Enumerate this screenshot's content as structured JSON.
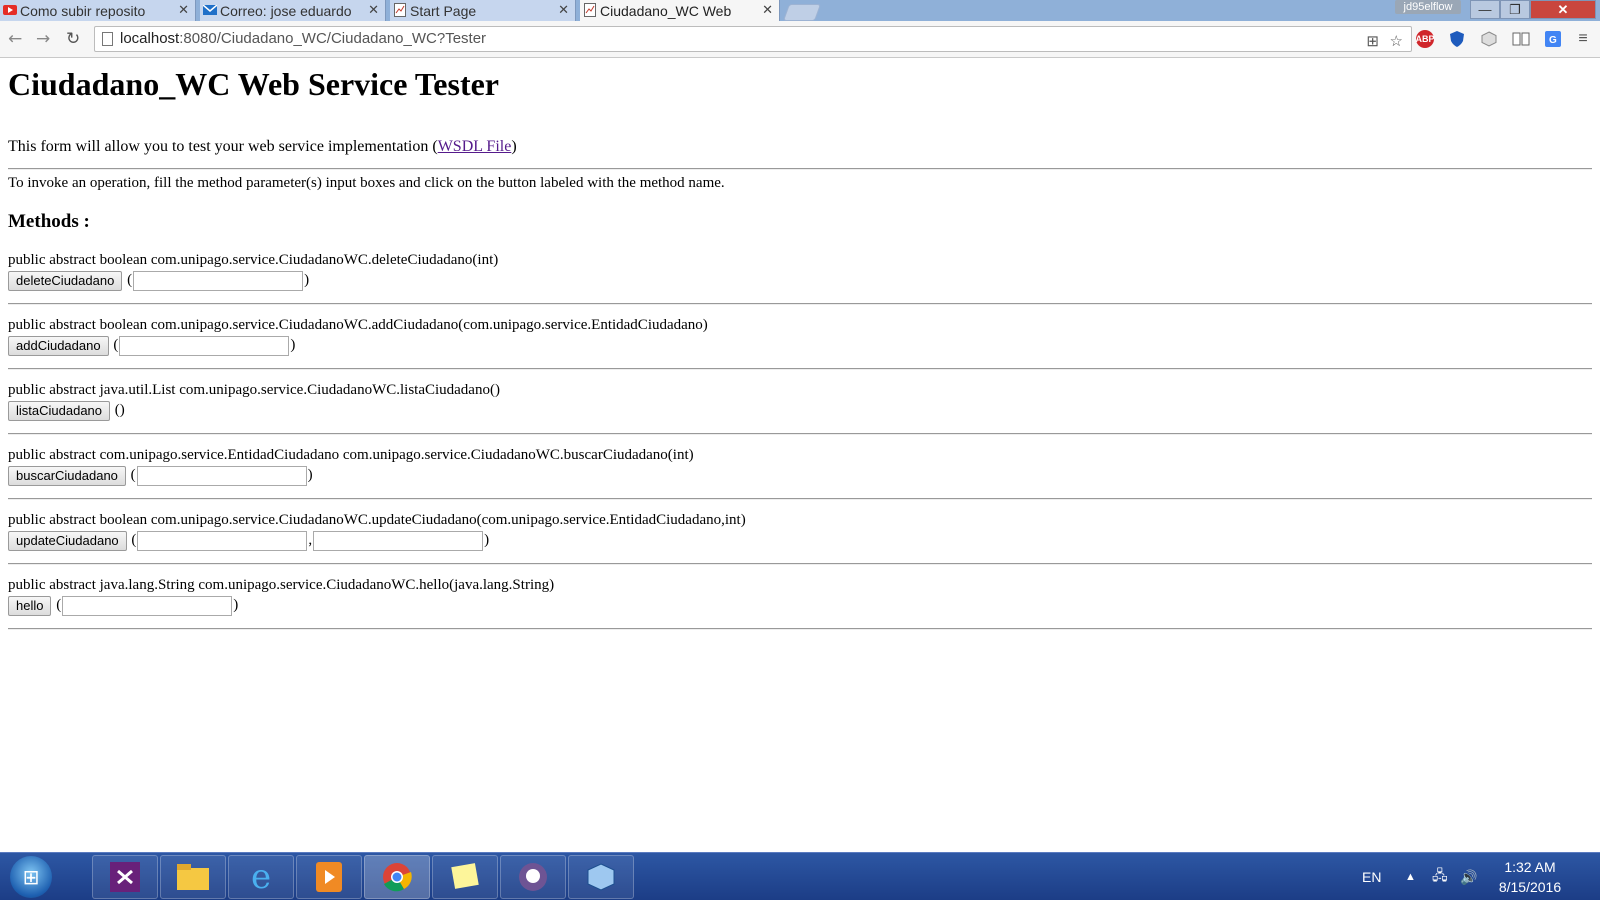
{
  "browser": {
    "tabs": [
      {
        "title": "Como subir reposito",
        "icon": "youtube-icon"
      },
      {
        "title": "Correo: jose eduardo",
        "icon": "mail-icon"
      },
      {
        "title": "Start Page",
        "icon": "page-icon"
      },
      {
        "title": "Ciudadano_WC Web",
        "icon": "page-icon",
        "active": true
      }
    ],
    "user_badge": "jd95elflow",
    "address": {
      "host": "localhost",
      "path": ":8080/Ciudadano_WC/Ciudadano_WC?Tester"
    },
    "extensions": [
      "abp-icon",
      "shield-icon",
      "cube-icon",
      "reader-icon",
      "translate-icon"
    ],
    "abp_label": "ABP"
  },
  "page": {
    "title": "Ciudadano_WC Web Service Tester",
    "intro_text": "This form will allow you to test your web service implementation (",
    "wsdl_link": "WSDL File",
    "intro_close": ")",
    "invoke_text": "To invoke an operation, fill the method parameter(s) input boxes and click on the button labeled with the method name.",
    "methods_heading": "Methods :",
    "methods": [
      {
        "signature": "public abstract boolean com.unipago.service.CiudadanoWC.deleteCiudadano(int)",
        "button": "deleteCiudadano",
        "inputs": 1
      },
      {
        "signature": "public abstract boolean com.unipago.service.CiudadanoWC.addCiudadano(com.unipago.service.EntidadCiudadano)",
        "button": "addCiudadano",
        "inputs": 1
      },
      {
        "signature": "public abstract java.util.List com.unipago.service.CiudadanoWC.listaCiudadano()",
        "button": "listaCiudadano",
        "inputs": 0
      },
      {
        "signature": "public abstract com.unipago.service.EntidadCiudadano com.unipago.service.CiudadanoWC.buscarCiudadano(int)",
        "button": "buscarCiudadano",
        "inputs": 1
      },
      {
        "signature": "public abstract boolean com.unipago.service.CiudadanoWC.updateCiudadano(com.unipago.service.EntidadCiudadano,int)",
        "button": "updateCiudadano",
        "inputs": 2
      },
      {
        "signature": "public abstract java.lang.String com.unipago.service.CiudadanoWC.hello(java.lang.String)",
        "button": "hello",
        "inputs": 1
      }
    ]
  },
  "taskbar": {
    "apps": [
      "visual-studio-icon",
      "file-explorer-icon",
      "internet-explorer-icon",
      "media-player-icon",
      "chrome-icon",
      "sticky-notes-icon",
      "github-icon",
      "virtualbox-icon"
    ],
    "language": "EN",
    "time": "1:32 AM",
    "date": "8/15/2016"
  },
  "colors": {
    "link": "#551a8b",
    "taskbar": "#1c3d86",
    "tab_active": "#f6f6f6"
  }
}
